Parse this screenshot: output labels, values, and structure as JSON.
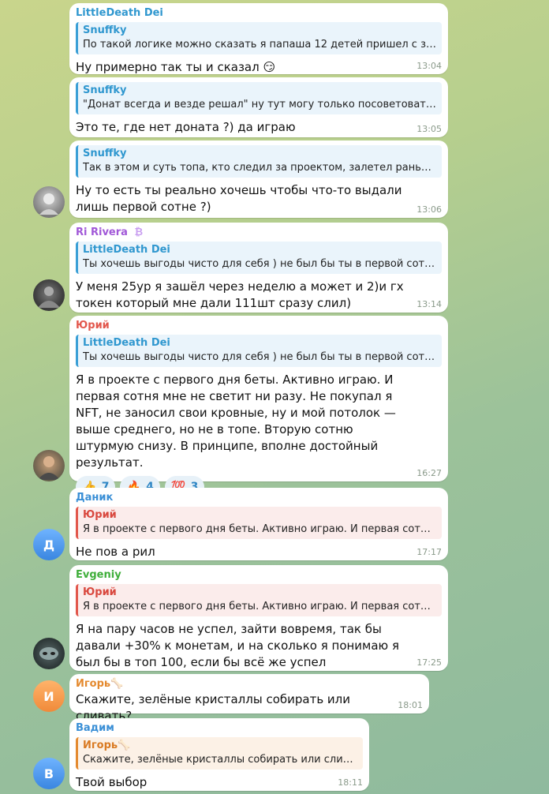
{
  "messages": [
    {
      "sender": "LittleDeath Dei",
      "reply_name": "Snuffky",
      "reply_text": "По такой логике можно сказать я папаша 12 детей пришел с заво...",
      "text": "Ну примерно так ты и сказал 😏",
      "time": "13:04"
    },
    {
      "sender": "",
      "reply_name": "Snuffky",
      "reply_text": "\"Донат всегда и везде решал\" ну тут могу только посоветовать иг...",
      "text": "Это те, где нет доната ?) да играю",
      "time": "13:05"
    },
    {
      "sender": "",
      "reply_name": "Snuffky",
      "reply_text": "Так в этом и суть топа, кто следил за проектом, залетел раньше и ...",
      "text": "Ну то есть ты реально хочешь чтобы что-то выдали лишь первой сотне ?)",
      "time": "13:06"
    },
    {
      "sender": "Ri Rivera",
      "sender_badge": "₿",
      "reply_name": "LittleDeath Dei",
      "reply_text": "Ты хочешь выгоды чисто для себя ) не был бы ты в первой сотне -...",
      "text": "У меня 25ур я зашёл через неделю а может и 2)и гх токен который мне дали 111шт сразу слил)",
      "time": "13:14"
    },
    {
      "sender": "Юрий",
      "reply_name": "LittleDeath Dei",
      "reply_text": "Ты хочешь выгоды чисто для себя ) не был бы ты в первой сотне -...",
      "text": "Я в проекте с первого дня беты. Активно играю. И первая сотня мне не светит ни разу. Не покупал я NFT, не заносил свои кровные, ну и мой потолок — выше среднего, но не в топе. Вторую сотню штурмую снизу.  В принципе, вполне достойный результат.",
      "time": "16:27",
      "reactions": [
        {
          "emoji": "👍",
          "count": "7"
        },
        {
          "emoji": "🔥",
          "count": "4"
        },
        {
          "emoji": "💯",
          "count": "3"
        }
      ]
    },
    {
      "sender": "Даник",
      "reply_name": "Юрий",
      "reply_text": "Я в проекте с первого дня беты. Активно играю. И первая сотня м...",
      "text": "Не пов а рил",
      "time": "17:17"
    },
    {
      "sender": "Evgeniy",
      "reply_name": "Юрий",
      "reply_text": "Я в проекте с первого дня беты. Активно играю. И первая сотня м...",
      "text": "Я на пару часов не успел, зайти вовремя, так бы давали +30% к монетам, и на сколько я понимаю я был бы в топ 100, если бы всё же успел",
      "time": "17:25"
    },
    {
      "sender": "Игорь🦴",
      "text": "Скажите,  зелёные кристаллы собирать или сливать?",
      "time": "18:01"
    },
    {
      "sender": "Вадим",
      "reply_name": "Игорь🦴",
      "reply_text": "Скажите, зелёные кристаллы собирать или сливать?",
      "text": "Твой выбор",
      "time": "18:11"
    }
  ],
  "avatars": {
    "danik": "Д",
    "igor": "И",
    "vadim": "В"
  },
  "colors": {
    "link": "#2f97cf",
    "ri": "#a158d8",
    "yuri": "#e2574c",
    "danik": "#3a8fd6",
    "evgeniy": "#3fae3a",
    "igor": "#e48a2f",
    "vadim": "#3a8fd6"
  }
}
